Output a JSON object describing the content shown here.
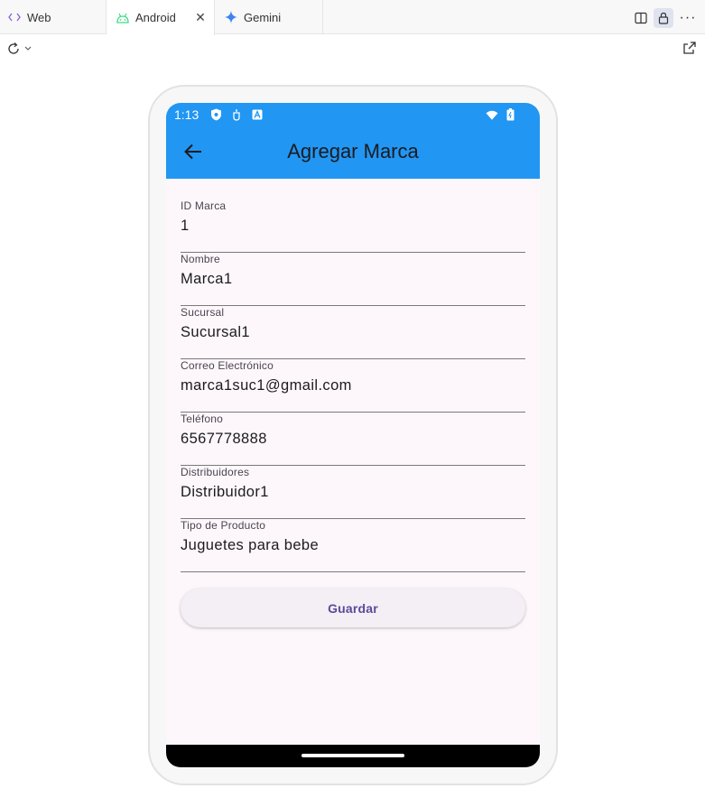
{
  "tabs": [
    {
      "label": "Web",
      "icon": "code-icon"
    },
    {
      "label": "Android",
      "icon": "android-icon",
      "active": true
    },
    {
      "label": "Gemini",
      "icon": "gemini-sparkle-icon"
    }
  ],
  "status_bar": {
    "time": "1:13"
  },
  "app_bar": {
    "title": "Agregar Marca"
  },
  "form": {
    "fields": [
      {
        "label": "ID Marca",
        "value": "1"
      },
      {
        "label": "Nombre",
        "value": "Marca1"
      },
      {
        "label": "Sucursal",
        "value": "Sucursal1"
      },
      {
        "label": "Correo Electrónico",
        "value": "marca1suc1@gmail.com"
      },
      {
        "label": "Teléfono",
        "value": "6567778888"
      },
      {
        "label": "Distribuidores",
        "value": "Distribuidor1"
      },
      {
        "label": "Tipo de Producto",
        "value": "Juguetes para bebe"
      }
    ],
    "save_label": "Guardar"
  },
  "colors": {
    "app_bar": "#2196f3",
    "screen_bg": "#fdf7fb",
    "button_text": "#5b4a9a"
  }
}
